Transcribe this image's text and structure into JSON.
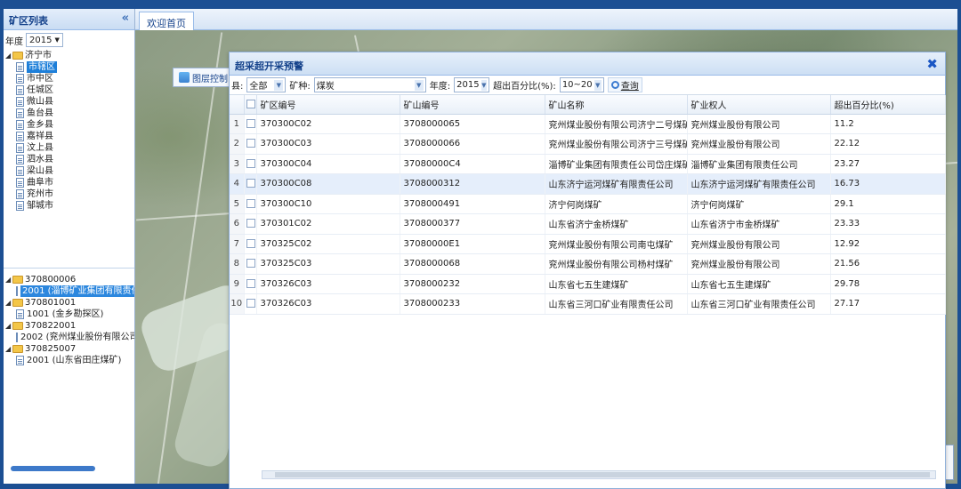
{
  "left_panel": {
    "title": "矿区列表",
    "year_label": "年度",
    "year_value": "2015",
    "tree_top": [
      {
        "label": "济宁市",
        "type": "folder"
      },
      {
        "label": "市辖区",
        "type": "file",
        "selected": true
      },
      {
        "label": "市中区",
        "type": "file"
      },
      {
        "label": "任城区",
        "type": "file"
      },
      {
        "label": "微山县",
        "type": "file"
      },
      {
        "label": "鱼台县",
        "type": "file"
      },
      {
        "label": "金乡县",
        "type": "file"
      },
      {
        "label": "嘉祥县",
        "type": "file"
      },
      {
        "label": "汶上县",
        "type": "file"
      },
      {
        "label": "泗水县",
        "type": "file"
      },
      {
        "label": "梁山县",
        "type": "file"
      },
      {
        "label": "曲阜市",
        "type": "file"
      },
      {
        "label": "兖州市",
        "type": "file"
      },
      {
        "label": "邹城市",
        "type": "file"
      }
    ],
    "tree_bottom": [
      {
        "label": "370800006",
        "type": "folder"
      },
      {
        "label": "2001 (淄博矿业集团有限责任",
        "type": "file",
        "selected": true
      },
      {
        "label": "370801001",
        "type": "folder"
      },
      {
        "label": "1001 (金乡勘探区)",
        "type": "file"
      },
      {
        "label": "370822001",
        "type": "folder"
      },
      {
        "label": "2002 (兖州煤业股份有限公司",
        "type": "file"
      },
      {
        "label": "370825007",
        "type": "folder"
      },
      {
        "label": "2001 (山东省田庄煤矿)",
        "type": "file"
      }
    ]
  },
  "main": {
    "tab_label": "欢迎首页",
    "layer_button": "图层控制",
    "legend_title": "控制"
  },
  "dialog": {
    "title": "超采超开采预警",
    "filters": {
      "county_label": "县:",
      "county_value": "全部",
      "mineral_label": "矿种:",
      "mineral_value": "煤炭",
      "year_label": "年度:",
      "year_value": "2015",
      "percent_label": "超出百分比(%):",
      "percent_value": "10~20",
      "query_button": "查询"
    },
    "columns": [
      "矿区编号",
      "矿山编号",
      "矿山名称",
      "矿业权人",
      "超出百分比(%)"
    ],
    "rows": [
      {
        "no": "1",
        "area": "370300C02",
        "mine": "3708000065",
        "name": "兖州煤业股份有限公司济宁二号煤矿",
        "owner": "兖州煤业股份有限公司",
        "pct": "11.2"
      },
      {
        "no": "2",
        "area": "370300C03",
        "mine": "3708000066",
        "name": "兖州煤业股份有限公司济宁三号煤矿",
        "owner": "兖州煤业股份有限公司",
        "pct": "22.12"
      },
      {
        "no": "3",
        "area": "370300C04",
        "mine": "37080000C4",
        "name": "淄博矿业集团有限责任公司岱庄煤矿",
        "owner": "淄博矿业集团有限责任公司",
        "pct": "23.27"
      },
      {
        "no": "4",
        "area": "370300C08",
        "mine": "3708000312",
        "name": "山东济宁运河煤矿有限责任公司",
        "owner": "山东济宁运河煤矿有限责任公司",
        "pct": "16.73"
      },
      {
        "no": "5",
        "area": "370300C10",
        "mine": "3708000491",
        "name": "济宁何岗煤矿",
        "owner": "济宁何岗煤矿",
        "pct": "29.1"
      },
      {
        "no": "6",
        "area": "370301C02",
        "mine": "3708000377",
        "name": "山东省济宁金桥煤矿",
        "owner": "山东省济宁市金桥煤矿",
        "pct": "23.33"
      },
      {
        "no": "7",
        "area": "370325C02",
        "mine": "37080000E1",
        "name": "兖州煤业股份有限公司南屯煤矿",
        "owner": "兖州煤业股份有限公司",
        "pct": "12.92"
      },
      {
        "no": "8",
        "area": "370325C03",
        "mine": "3708000068",
        "name": "兖州煤业股份有限公司杨村煤矿",
        "owner": "兖州煤业股份有限公司",
        "pct": "21.56"
      },
      {
        "no": "9",
        "area": "370326C03",
        "mine": "3708000232",
        "name": "山东省七五生建煤矿",
        "owner": "山东省七五生建煤矿",
        "pct": "29.78"
      },
      {
        "no": "10",
        "area": "370326C03",
        "mine": "3708000233",
        "name": "山东省三河口矿业有限责任公司",
        "owner": "山东省三河口矿业有限责任公司",
        "pct": "27.17"
      }
    ]
  }
}
